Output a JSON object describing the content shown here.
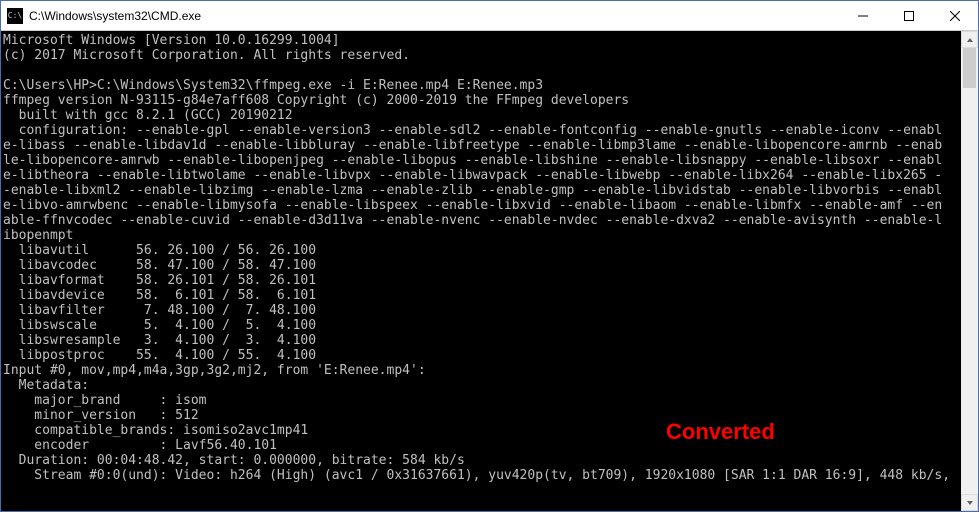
{
  "window": {
    "title": "C:\\Windows\\system32\\CMD.exe"
  },
  "terminal": {
    "lines": "Microsoft Windows [Version 10.0.16299.1004]\n(c) 2017 Microsoft Corporation. All rights reserved.\n\nC:\\Users\\HP>C:\\Windows\\System32\\ffmpeg.exe -i E:Renee.mp4 E:Renee.mp3\nffmpeg version N-93115-g84e7aff608 Copyright (c) 2000-2019 the FFmpeg developers\n  built with gcc 8.2.1 (GCC) 20190212\n  configuration: --enable-gpl --enable-version3 --enable-sdl2 --enable-fontconfig --enable-gnutls --enable-iconv --enabl\ne-libass --enable-libdav1d --enable-libbluray --enable-libfreetype --enable-libmp3lame --enable-libopencore-amrnb --enab\nle-libopencore-amrwb --enable-libopenjpeg --enable-libopus --enable-libshine --enable-libsnappy --enable-libsoxr --enabl\ne-libtheora --enable-libtwolame --enable-libvpx --enable-libwavpack --enable-libwebp --enable-libx264 --enable-libx265 -\n-enable-libxml2 --enable-libzimg --enable-lzma --enable-zlib --enable-gmp --enable-libvidstab --enable-libvorbis --enabl\ne-libvo-amrwbenc --enable-libmysofa --enable-libspeex --enable-libxvid --enable-libaom --enable-libmfx --enable-amf --en\nable-ffnvcodec --enable-cuvid --enable-d3d11va --enable-nvenc --enable-nvdec --enable-dxva2 --enable-avisynth --enable-l\nibopenmpt\n  libavutil      56. 26.100 / 56. 26.100\n  libavcodec     58. 47.100 / 58. 47.100\n  libavformat    58. 26.101 / 58. 26.101\n  libavdevice    58.  6.101 / 58.  6.101\n  libavfilter     7. 48.100 /  7. 48.100\n  libswscale      5.  4.100 /  5.  4.100\n  libswresample   3.  4.100 /  3.  4.100\n  libpostproc    55.  4.100 / 55.  4.100\nInput #0, mov,mp4,m4a,3gp,3g2,mj2, from 'E:Renee.mp4':\n  Metadata:\n    major_brand     : isom\n    minor_version   : 512\n    compatible_brands: isomiso2avc1mp41\n    encoder         : Lavf56.40.101\n  Duration: 00:04:48.42, start: 0.000000, bitrate: 584 kb/s\n    Stream #0:0(und): Video: h264 (High) (avc1 / 0x31637661), yuv420p(tv, bt709), 1920x1080 [SAR 1:1 DAR 16:9], 448 kb/s,"
  },
  "annotation": {
    "text": "Converted",
    "color": "#ff0000"
  }
}
